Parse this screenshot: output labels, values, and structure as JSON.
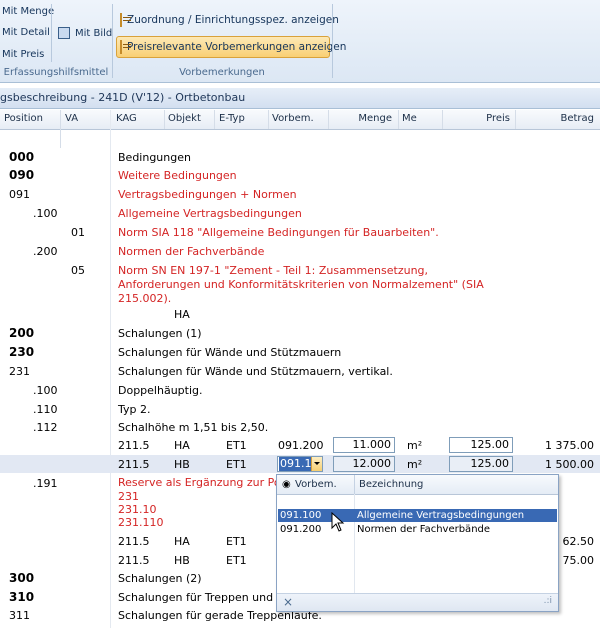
{
  "ribbon": {
    "mit_menge": "Mit Menge",
    "mit_detail": "Mit Detail",
    "mit_preis": "Mit Preis",
    "mit_bild": "Mit Bild",
    "group1_label": "Erfassungshilfsmittel",
    "zuordnung": "Zuordnung / Einrichtungsspez. anzeigen",
    "preisrelevante": "Preisrelevante Vorbemerkungen anzeigen",
    "group2_label": "Vorbemerkungen"
  },
  "doc_tab": "gsbeschreibung - 241D (V'12) - Ortbetonbau",
  "columns": [
    "Position",
    "VA",
    "KAG",
    "Objekt",
    "E-Typ",
    "Vorbem.",
    "Menge",
    "Me",
    "Preis",
    "Betrag"
  ],
  "rows": {
    "r0_pos": "000",
    "r0_text": "Bedingungen",
    "r1_pos": "090",
    "r1_text": "Weitere Bedingungen",
    "r2_pos": "091",
    "r2_text": "Vertragsbedingungen + Normen",
    "r3_pos": ".100",
    "r3_text": "Allgemeine Vertragsbedingungen",
    "r4_va": "01",
    "r4_text": "Norm SIA 118 \"Allgemeine Bedingungen für Bauarbeiten\".",
    "r5_pos": ".200",
    "r5_text": "Normen der Fachverbände",
    "r6_va": "05",
    "r6_l1": "Norm SN EN 197-1  \"Zement - Teil 1: Zusammensetzung,",
    "r6_l2": "Anforderungen und Konformitätskriterien von Normalzement\" (SIA",
    "r6_l3": "215.002).",
    "r7_obj": "HA",
    "r8_pos": "200",
    "r8_text": "Schalungen (1)",
    "r9_pos": "230",
    "r9_text": "Schalungen für Wände und Stützmauern",
    "r10_pos": "231",
    "r10_text": "Schalungen für Wände und Stützmauern, vertikal.",
    "r11_pos": ".100",
    "r11_text": "Doppelhäuptig.",
    "r12_pos": ".110",
    "r12_text": "Typ 2.",
    "r13_pos": ".112",
    "r13_text": "Schalhöhe m 1,51 bis 2,50.",
    "r14_kag": "211.5",
    "r14_obj": "HA",
    "r14_etyp": "ET1",
    "r14_vorbem": "091.200",
    "r14_menge": "11.000",
    "r14_me": "m²",
    "r14_preis": "125.00",
    "r14_betrag": "1 375.00",
    "r15_kag": "211.5",
    "r15_obj": "HB",
    "r15_etyp": "ET1",
    "r15_vorbem": "091.1",
    "r15_menge": "12.000",
    "r15_me": "m²",
    "r15_preis": "125.00",
    "r15_betrag": "1 500.00",
    "r16_pos": ".191",
    "r16_text": "Reserve als Ergänzung zur Posi",
    "r16_l2": "231",
    "r16_l3": "231.10",
    "r16_l4": "231.110",
    "r17_kag": "211.5",
    "r17_obj": "HA",
    "r17_etyp": "ET1",
    "r17_betrag": "62.50",
    "r18_kag": "211.5",
    "r18_obj": "HB",
    "r18_etyp": "ET1",
    "r18_betrag": "75.00",
    "r19_pos": "300",
    "r19_text": "Schalungen (2)",
    "r20_pos": "310",
    "r20_text": "Schalungen für Treppen und P",
    "r21_pos": "311",
    "r21_text": "Schalungen für gerade Treppenläufe."
  },
  "dropdown": {
    "col1": "Vorbem.",
    "col2": "Bezeichnung",
    "items": [
      {
        "code": "091.100",
        "name": "Allgemeine Vertragsbedingungen"
      },
      {
        "code": "091.200",
        "name": "Normen der Fachverbände"
      }
    ],
    "close": "×",
    "grip": ".:i"
  },
  "colors": {
    "accent": "#3969b4",
    "red_text": "#d42424",
    "ribbon_active": "#f9cf74"
  }
}
